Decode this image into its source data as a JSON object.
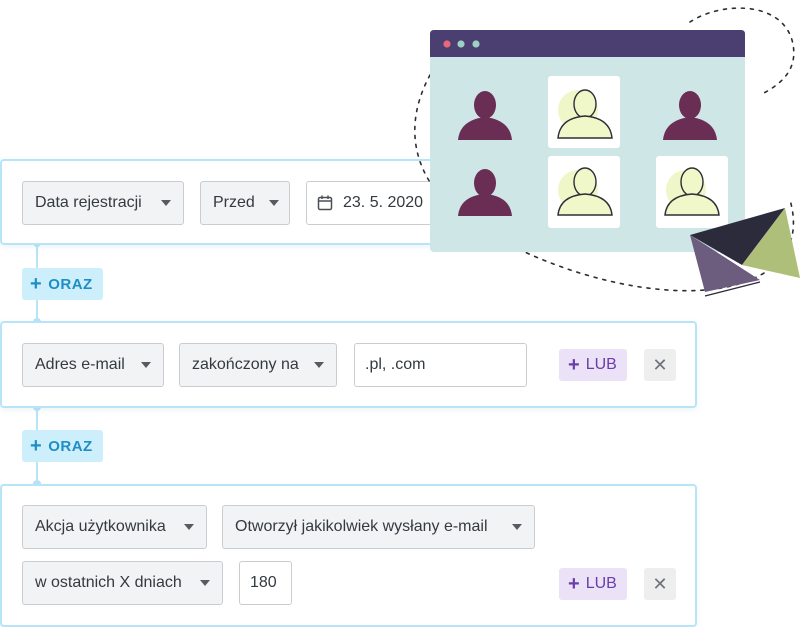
{
  "conditions": {
    "row1": {
      "field": "Data rejestracji",
      "operator": "Przed",
      "date_value": "23. 5. 2020"
    },
    "and1_label": "ORAZ",
    "row2": {
      "field": "Adres e-mail",
      "operator": "zakończony na",
      "value": ".pl, .com",
      "or_label": "LUB",
      "remove_label": "✕"
    },
    "and2_label": "ORAZ",
    "row3": {
      "field": "Akcja użytkownika",
      "operator": "Otworzył jakikolwiek wysłany e-mail",
      "period": "w ostatnich X dniach",
      "value": "180",
      "or_label": "LUB",
      "remove_label": "✕"
    }
  },
  "icons": {
    "plus": "+",
    "calendar": "calendar-icon",
    "caret": "chevron-down-icon"
  },
  "colors": {
    "accent_blue": "#1d8fc6",
    "lub_purple": "#6a3ea8",
    "window_header": "#4b3f72",
    "window_bg": "#cfe6e6",
    "avatar_dark": "#6a2e55",
    "avatar_light": "#f0f7c8"
  }
}
